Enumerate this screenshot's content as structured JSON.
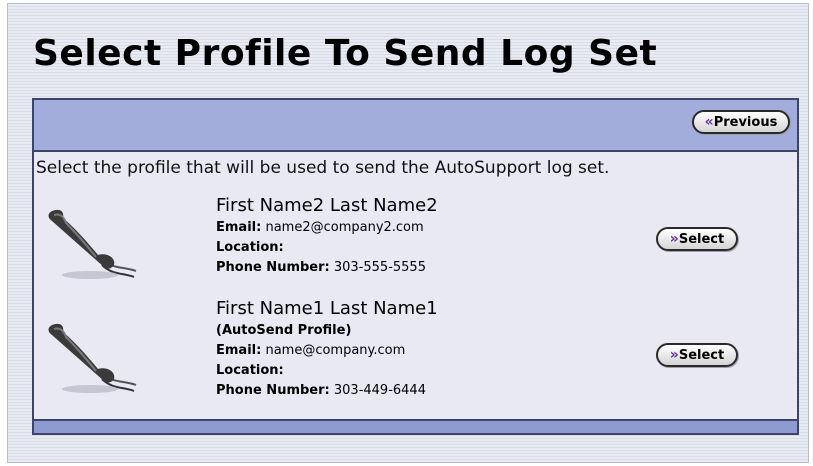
{
  "page": {
    "title": "Select Profile To Send Log Set"
  },
  "header": {
    "previous_label": "Previous"
  },
  "instruction": "Select the profile that will be used to send the AutoSupport log set.",
  "labels": {
    "email": "Email:",
    "location": "Location:",
    "phone": "Phone Number:"
  },
  "profiles": [
    {
      "name": "First Name2 Last Name2",
      "note": "",
      "email": "name2@company2.com",
      "location": "",
      "phone": "303-555-5555",
      "select_label": "Select"
    },
    {
      "name": "First Name1 Last Name1",
      "note": "(AutoSend Profile)",
      "email": "name@company.com",
      "location": "",
      "phone": "303-449-6444",
      "select_label": "Select"
    }
  ],
  "icons": {
    "profile_icon": "phone-handset-icon",
    "button_icon": "double-chevron-icon"
  },
  "colors": {
    "header_band": "#a2addb",
    "footer_band": "#8e9bd0",
    "panel_border": "#3c4468",
    "chevron": "#6a2f9a"
  }
}
